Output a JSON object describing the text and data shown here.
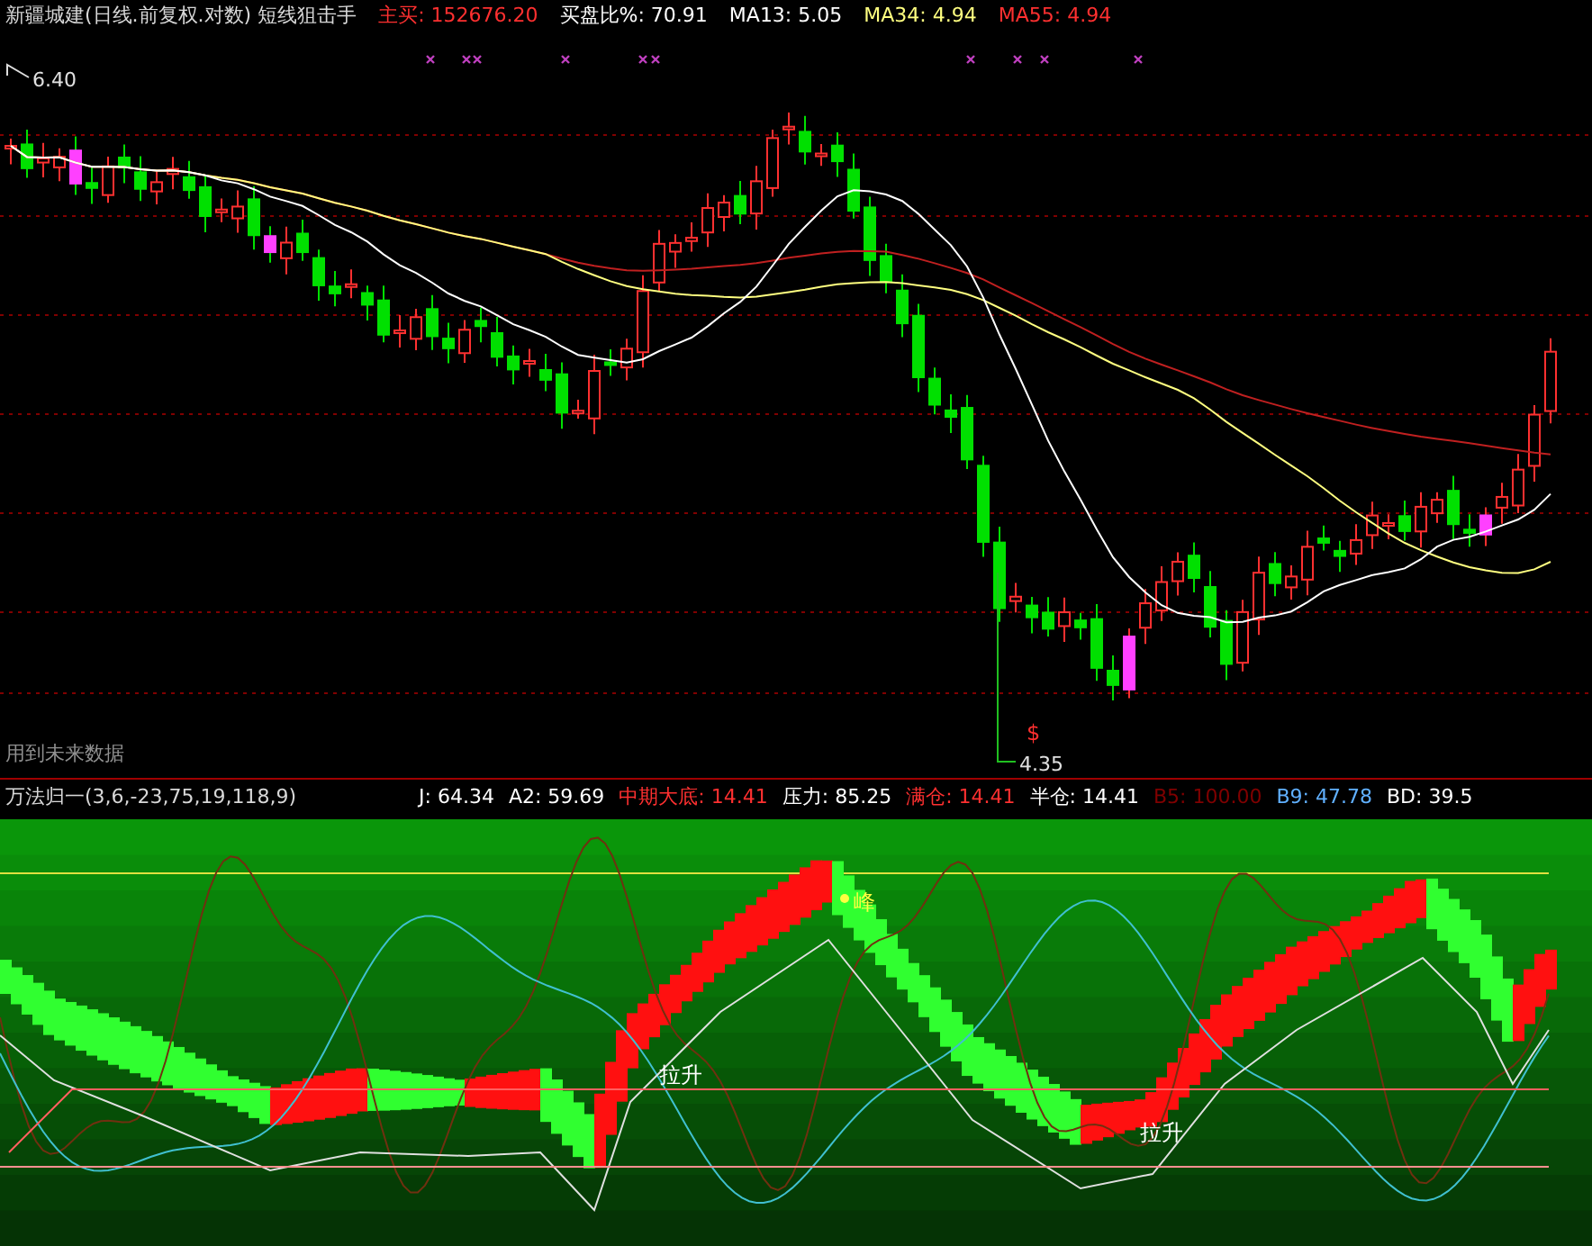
{
  "header": {
    "title": "新疆城建(日线.前复权.对数) 短线狙击手",
    "indicators": [
      {
        "label": "主买: 152676.20",
        "color": "#ff3030"
      },
      {
        "label": "买盘比%: 70.91",
        "color": "#ffffff"
      },
      {
        "label": "MA13: 5.05",
        "color": "#ffffff"
      },
      {
        "label": "MA34: 4.94",
        "color": "#ffff80"
      },
      {
        "label": "MA55: 4.94",
        "color": "#ff3030"
      }
    ]
  },
  "price_chart": {
    "high_label": "6.40",
    "low_label": "4.35",
    "signal_mark": "$",
    "note": "用到未来数据"
  },
  "indicator_header": {
    "title": "万法归一(3,6,-23,75,19,118,9)",
    "values": [
      {
        "label": "J: 64.34",
        "color": "#ffffff"
      },
      {
        "label": "A2: 59.69",
        "color": "#ffffff"
      },
      {
        "label": "中期大底: 14.41",
        "color": "#ff3030"
      },
      {
        "label": "压力: 85.25",
        "color": "#ffffff"
      },
      {
        "label": "满仓: 14.41",
        "color": "#ff3030"
      },
      {
        "label": "半仓: 14.41",
        "color": "#ffffff"
      },
      {
        "label": "B5: 100.00",
        "color": "#800000"
      },
      {
        "label": "B9: 47.78",
        "color": "#60b0ff"
      },
      {
        "label": "BD: 39.5",
        "color": "#ffffff"
      }
    ]
  },
  "indicator_chart": {
    "peak_label": "峰",
    "rise_labels": [
      "拉升",
      "拉升"
    ]
  }
}
